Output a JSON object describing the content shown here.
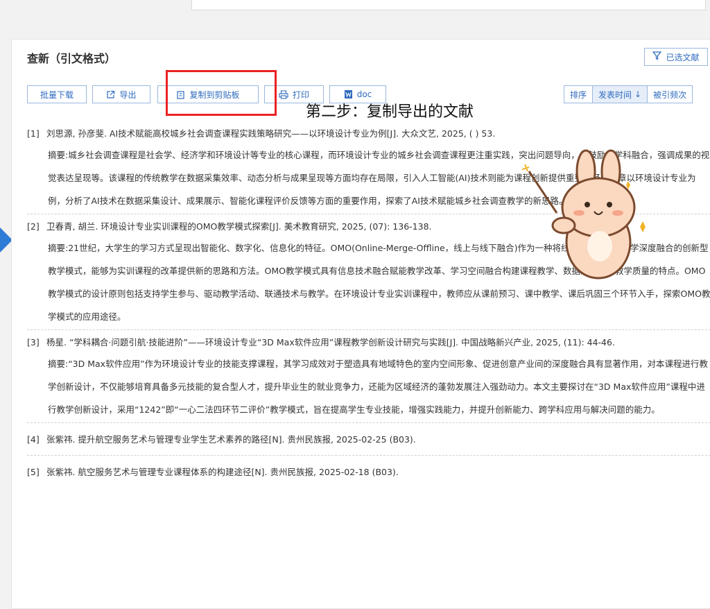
{
  "panel": {
    "title": "查新（引文格式）",
    "selected_label": "已选文献"
  },
  "toolbar": {
    "batch_download": "批量下载",
    "export": "导出",
    "copy_clipboard": "复制到剪贴板",
    "print": "打印",
    "doc": "doc",
    "sort": "排序",
    "sort_pubtime": "发表时间",
    "sort_cited": "被引频次"
  },
  "annotation": "第二步：复制导出的文献",
  "refs": [
    {
      "num": "[1]",
      "citation": "刘思源, 孙彦斐. AI技术赋能高校城乡社会调查课程实践策略研究——以环境设计专业为例[J]. 大众文艺, 2025, (      ) 53.",
      "abstract": "摘要:城乡社会调查课程是社会学、经济学和环境设计等专业的核心课程，而环境设计专业的城乡社会调查课程更注重实践，突出问题导向，并鼓励多学科融合，强调成果的视觉表达呈现等。该课程的传统教学在数据采集效率、动态分析与成果呈现等方面均存在局限，引入人工智能(AI)技术则能为课程创新提供重要路径。文章以环境设计专业为例，分析了AI技术在数据采集设计、成果展示、智能化课程评价反馈等方面的重要作用，探索了AI技术赋能城乡社会调查教学的新思路。"
    },
    {
      "num": "[2]",
      "citation": "卫春青, 胡兰. 环境设计专业实训课程的OMO教学模式探索[J]. 美术教育研究, 2025, (07): 136-138.",
      "abstract": "摘要:21世纪，大学生的学习方式呈现出智能化、数字化、信息化的特征。OMO(Online-Merge-Offline，线上与线下融合)作为一种将线上教学与线下教学深度融合的创新型教学模式，能够为实训课程的改革提供新的思路和方法。OMO教学模式具有信息技术融合赋能教学改革、学习空间融合构建课程教学、数据融合提升教学质量的特点。OMO教学模式的设计原则包括支持学生参与、驱动教学活动、联通技术与教学。在环境设计专业实训课程中，教师应从课前预习、课中教学、课后巩固三个环节入手，探索OMO教学模式的应用途径。"
    },
    {
      "num": "[3]",
      "citation": "杨星. “学科耦合·问题引航·技能进阶”——环境设计专业“3D Max软件应用”课程教学创新设计研究与实践[J]. 中国战略新兴产业, 2025, (11): 44-46.",
      "abstract": "摘要:“3D Max软件应用”作为环境设计专业的技能支撑课程，其学习成效对于塑造具有地域特色的室内空间形象、促进创意产业间的深度融合具有显著作用，对本课程进行教学创新设计，不仅能够培育具备多元技能的复合型人才，提升毕业生的就业竞争力，还能为区域经济的蓬勃发展注入强劲动力。本文主要探讨在“3D Max软件应用”课程中进行教学创新设计，采用“1242”即“一心二法四环节二评价”教学模式，旨在提高学生专业技能，增强实践能力，并提升创新能力、跨学科应用与解决问题的能力。"
    },
    {
      "num": "[4]",
      "citation": "张紫祎. 提升航空服务艺术与管理专业学生艺术素养的路径[N]. 贵州民族报, 2025-02-25 (B03).",
      "abstract": ""
    },
    {
      "num": "[5]",
      "citation": "张紫祎. 航空服务艺术与管理专业课程体系的构建途径[N]. 贵州民族报, 2025-02-18 (B03).",
      "abstract": ""
    }
  ]
}
